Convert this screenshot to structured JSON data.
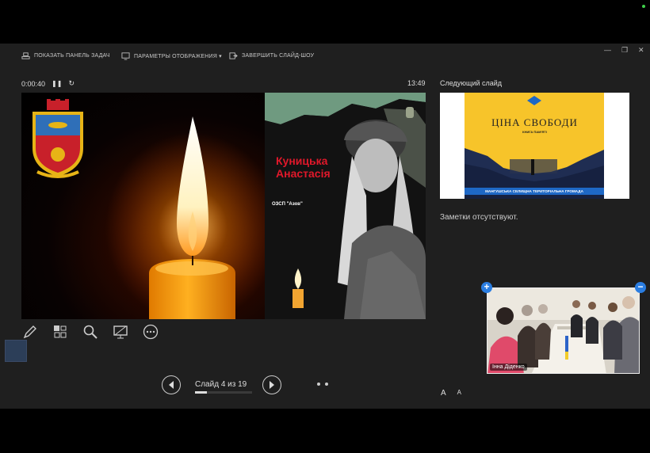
{
  "toolbar": {
    "show_taskbar": "ПОКАЗАТЬ ПАНЕЛЬ ЗАДАЧ",
    "display_settings": "ПАРАМЕТРЫ ОТОБРАЖЕНИЯ ▾",
    "end_show": "ЗАВЕРШИТЬ СЛАЙД-ШОУ"
  },
  "window_controls": {
    "minimize": "—",
    "restore": "❐",
    "close": "✕"
  },
  "presenter": {
    "elapsed": "0:00:40",
    "clock": "13:49"
  },
  "slide": {
    "name": "Куницька Анастасія",
    "unit": "ОЗСП \"Азов\""
  },
  "next_slide": {
    "heading": "Следующий слайд",
    "title": "ЦІНА СВОБОДИ",
    "subtitle": "КНИГА ПАМ'ЯТІ",
    "footer": "МАНГУШСЬКА СЕЛИЩНА ТЕРИТОРІАЛЬНА ГРОМАДА"
  },
  "notes": "Заметки отсутствуют.",
  "navigation": {
    "slide_label": "Слайд 4 из 19",
    "current": 4,
    "total": 19
  },
  "font_buttons": {
    "increase": "A",
    "decrease": "A"
  },
  "video": {
    "participant": "Інна Діденко",
    "add": "+",
    "remove": "−"
  },
  "colors": {
    "background": "#1f1f1f",
    "accent_blue": "#2a7de1",
    "caption_red": "#e0182a",
    "flame": "#f5a623"
  }
}
